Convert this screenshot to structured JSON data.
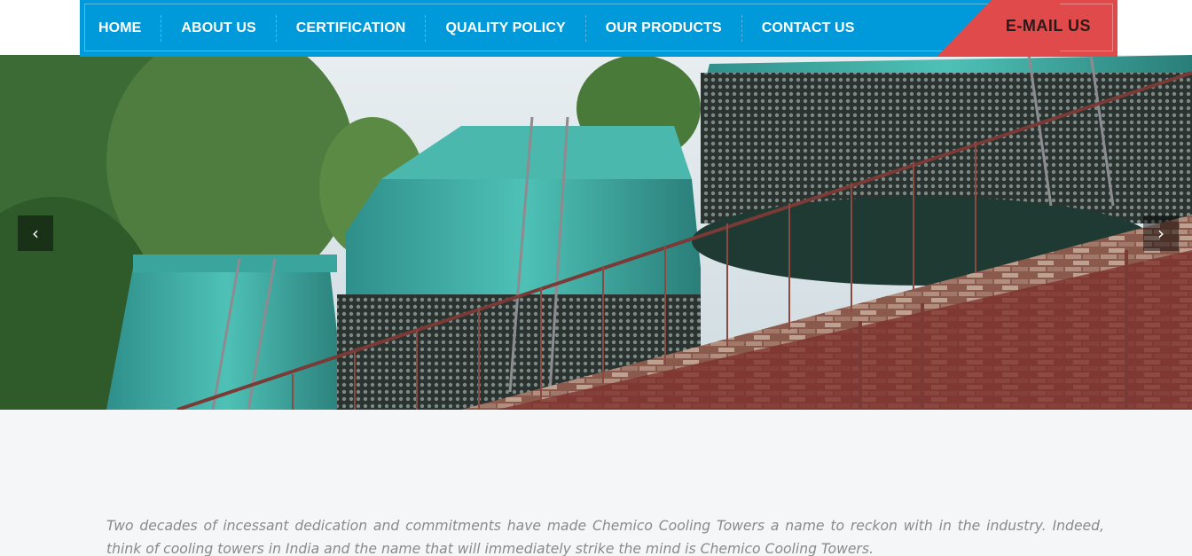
{
  "nav": {
    "items": [
      {
        "label": "HOME"
      },
      {
        "label": "ABOUT US"
      },
      {
        "label": "CERTIFICATION"
      },
      {
        "label": "QUALITY POLICY"
      },
      {
        "label": "OUR PRODUCTS"
      },
      {
        "label": "CONTACT US"
      }
    ],
    "email_label": "E-MAIL US",
    "colors": {
      "nav_bg": "#0099d9",
      "email_bg": "#e04a4a"
    }
  },
  "slider": {
    "prev_icon": "chevron-left-icon",
    "next_icon": "chevron-right-icon"
  },
  "intro": {
    "text": "Two decades of incessant dedication and commitments have made Chemico Cooling Towers a name to reckon with in the industry. Indeed, think of cooling towers in India and the name that will immediately strike the mind is Chemico Cooling Towers."
  }
}
